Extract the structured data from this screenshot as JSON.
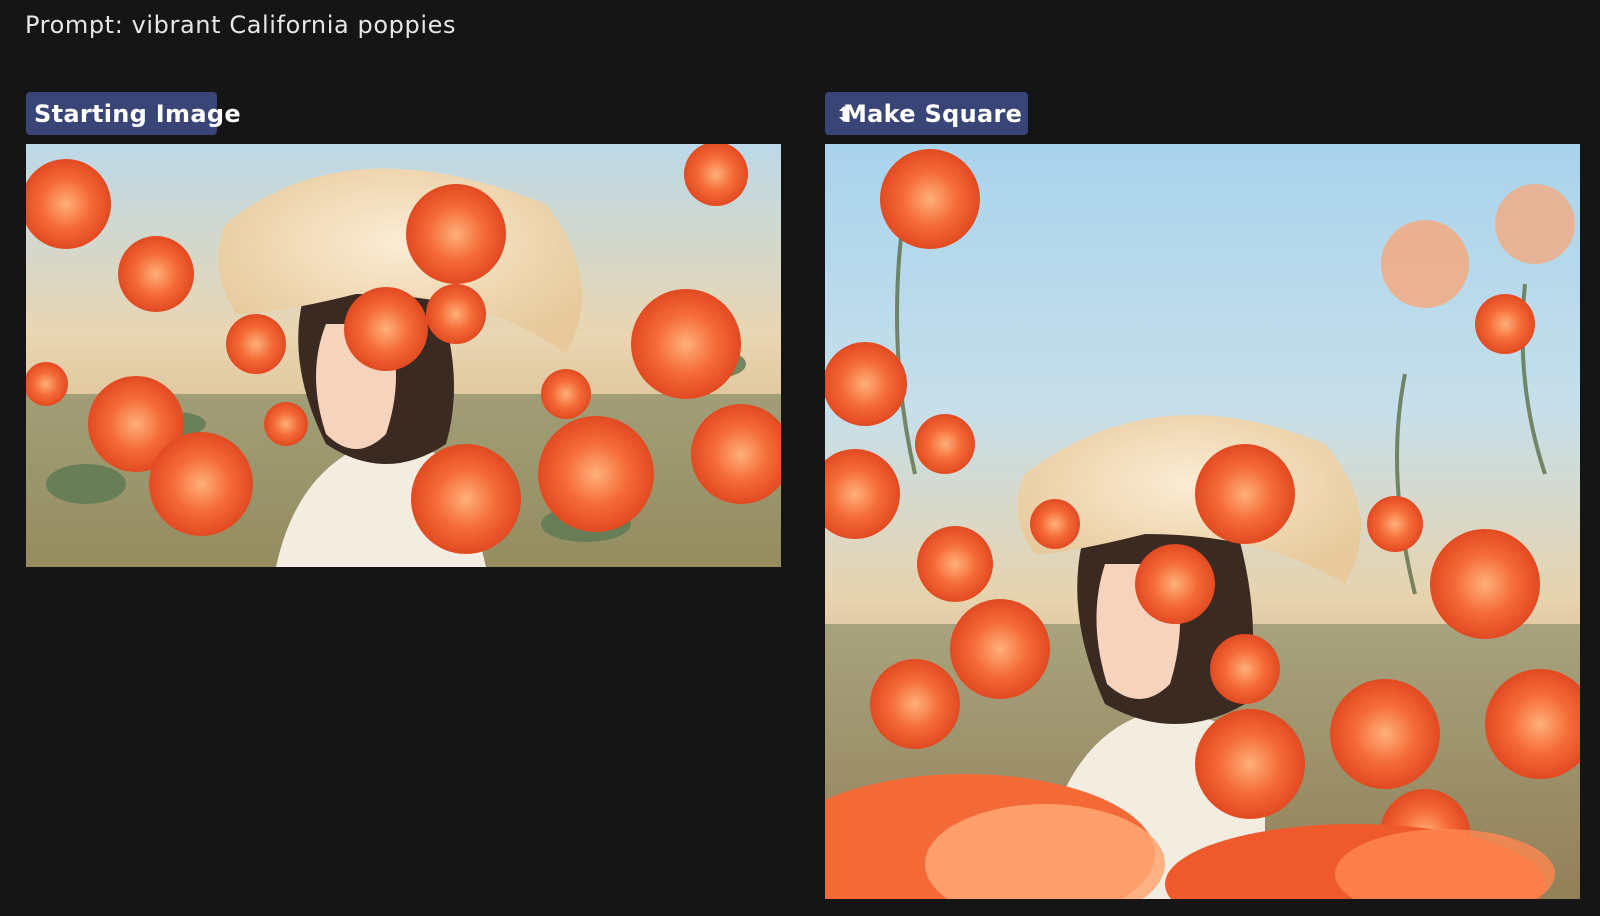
{
  "prompt": {
    "label": "Prompt: vibrant California poppies"
  },
  "panels": [
    {
      "badge_label": "Starting Image",
      "icon": null
    },
    {
      "badge_label": "Make Square",
      "icon": "up-down-arrow-icon"
    }
  ],
  "colors": {
    "background": "#151515",
    "badge": "#3a4577",
    "text": "#e6e6e6",
    "poppy": "#f2562a",
    "sky": "#a9d3ec"
  }
}
